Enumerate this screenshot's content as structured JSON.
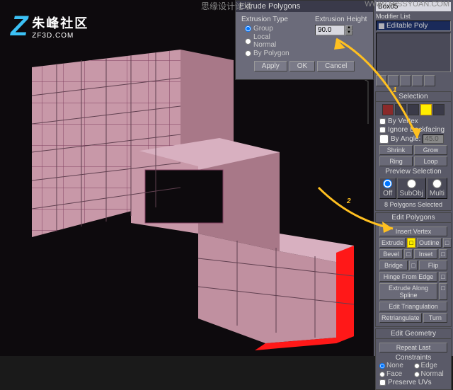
{
  "watermark": {
    "center": "思缘设计论坛",
    "right": "WWW.MISSYUAN.COM"
  },
  "logo": {
    "cn": "朱峰社区",
    "url": "ZF3D.COM"
  },
  "dialog": {
    "title": "Extrude Polygons",
    "type_label": "Extrusion Type",
    "height_label": "Extrusion Height",
    "opts": {
      "group": "Group",
      "local": "Local Normal",
      "poly": "By Polygon"
    },
    "value": "90.0",
    "apply": "Apply",
    "ok": "OK",
    "cancel": "Cancel"
  },
  "side": {
    "obj_name": "Box05",
    "modlist": "Modifier List",
    "modifier": "Editable Poly"
  },
  "sel": {
    "header": "Selection",
    "byvertex": "By Vertex",
    "ignore": "Ignore Backfacing",
    "byangle": "By Angle:",
    "angle": "45.0",
    "shrink": "Shrink",
    "grow": "Grow",
    "ring": "Ring",
    "loop": "Loop",
    "preview": "Preview Selection",
    "off": "Off",
    "subobj": "SubObj",
    "multi": "Multi",
    "count": "8 Polygons Selected"
  },
  "edit": {
    "header": "Edit Polygons",
    "insert_vertex": "Insert Vertex",
    "extrude": "Extrude",
    "outline": "Outline",
    "bevel": "Bevel",
    "inset": "Inset",
    "bridge": "Bridge",
    "flip": "Flip",
    "hinge": "Hinge From Edge",
    "spline": "Extrude Along Spline",
    "tri": "Edit Triangulation",
    "retri": "Retriangulate",
    "turn": "Turn"
  },
  "geo": {
    "header": "Edit Geometry",
    "repeat": "Repeat Last",
    "constraints": "Constraints",
    "none": "None",
    "edge": "Edge",
    "face": "Face",
    "normal": "Normal",
    "preserve": "Preserve UVs"
  },
  "annot": {
    "one": "1",
    "two": "2"
  }
}
